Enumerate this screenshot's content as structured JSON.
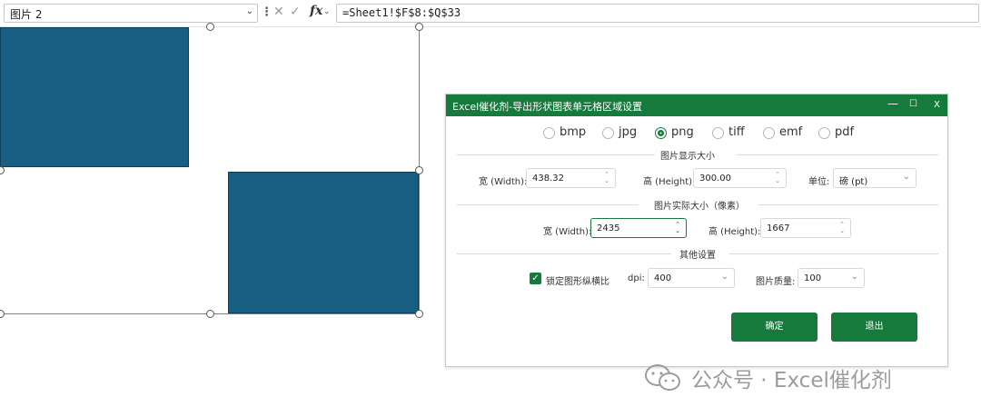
{
  "formula_bar": {
    "name_box": "图片 2",
    "fx_label": "fx",
    "formula": "=Sheet1!$F$8:$Q$33"
  },
  "dialog": {
    "title": "Excel催化剂-导出形状图表单元格区域设置",
    "window_buttons": {
      "minimize": "—",
      "maximize": "☐",
      "close": "X"
    },
    "formats": [
      {
        "label": "bmp",
        "selected": false
      },
      {
        "label": "jpg",
        "selected": false
      },
      {
        "label": "png",
        "selected": true
      },
      {
        "label": "tiff",
        "selected": false
      },
      {
        "label": "emf",
        "selected": false
      },
      {
        "label": "pdf",
        "selected": false
      }
    ],
    "display_size": {
      "section_title": "图片显示大小",
      "width_label": "宽 (Width):",
      "width_value": "438.32",
      "height_label": "高 (Height):",
      "height_value": "300.00",
      "unit_label": "单位:",
      "unit_value": "磅 (pt)"
    },
    "actual_size": {
      "section_title": "图片实际大小（像素）",
      "width_label": "宽 (Width):",
      "width_value": "2435",
      "height_label": "高 (Height):",
      "height_value": "1667"
    },
    "other": {
      "section_title": "其他设置",
      "lock_ratio_label": "锁定图形纵横比",
      "lock_ratio_checked": true,
      "dpi_label": "dpi:",
      "dpi_value": "400",
      "quality_label": "图片质量:",
      "quality_value": "100"
    },
    "confirm_label": "确定",
    "exit_label": "退出"
  },
  "watermark": {
    "text": "公众号 · Excel催化剂"
  },
  "colors": {
    "accent": "#177a3d",
    "shape_fill": "#165f82"
  }
}
